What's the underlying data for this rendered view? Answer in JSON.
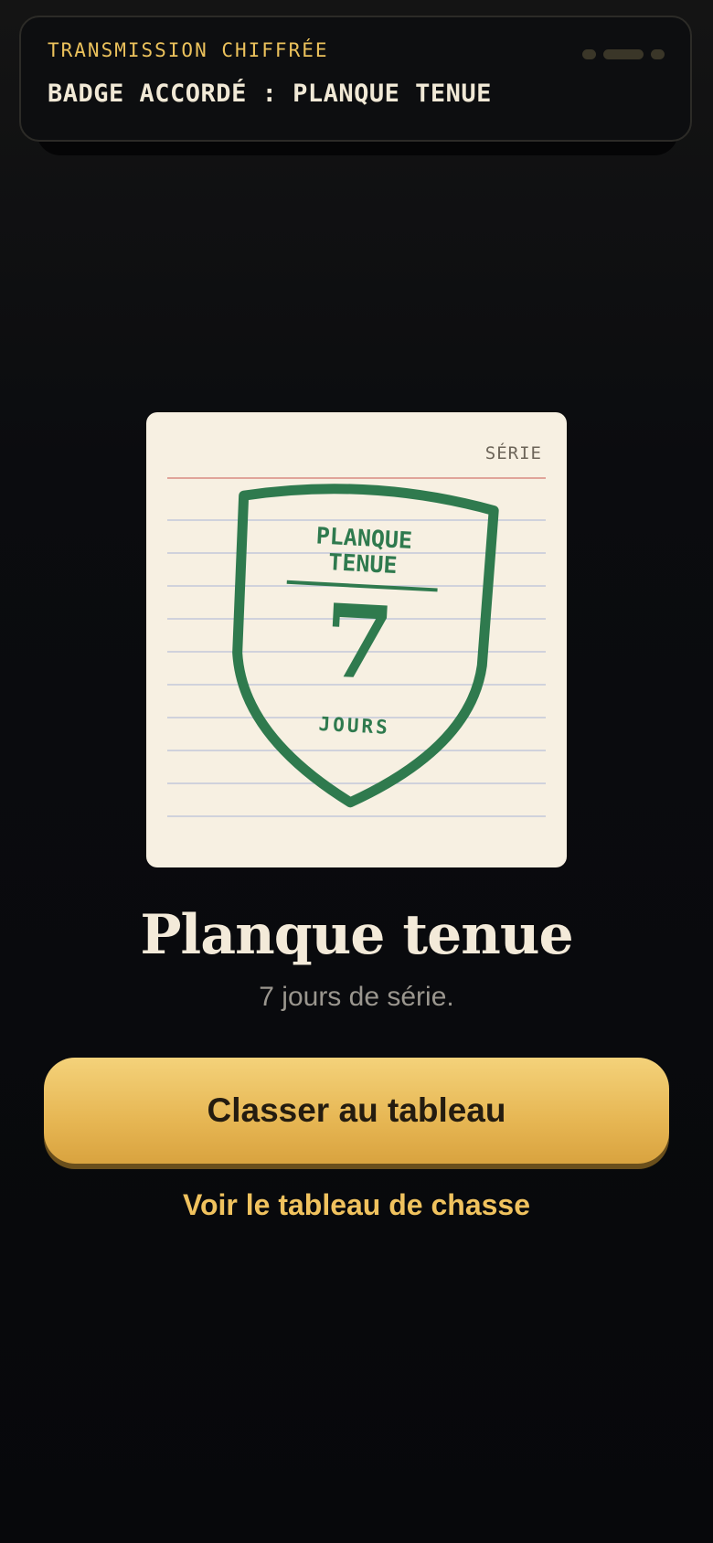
{
  "notification": {
    "kicker": "TRANSMISSION CHIFFRÉE",
    "message": "BADGE ACCORDÉ : PLANQUE TENUE"
  },
  "card": {
    "tag": "SÉRIE",
    "badge": {
      "line1": "PLANQUE",
      "line2": "TENUE",
      "number": "7",
      "unit": "JOURS",
      "color": "#2f7a4e"
    }
  },
  "achievement": {
    "title": "Planque tenue",
    "subtitle": "7 jours de série."
  },
  "actions": {
    "primary_label": "Classer au tableau",
    "secondary_label": "Voir le tableau de chasse"
  },
  "colors": {
    "accent": "#ecc25c",
    "background": "#0a0b0e",
    "card": "#f7f0e2"
  }
}
